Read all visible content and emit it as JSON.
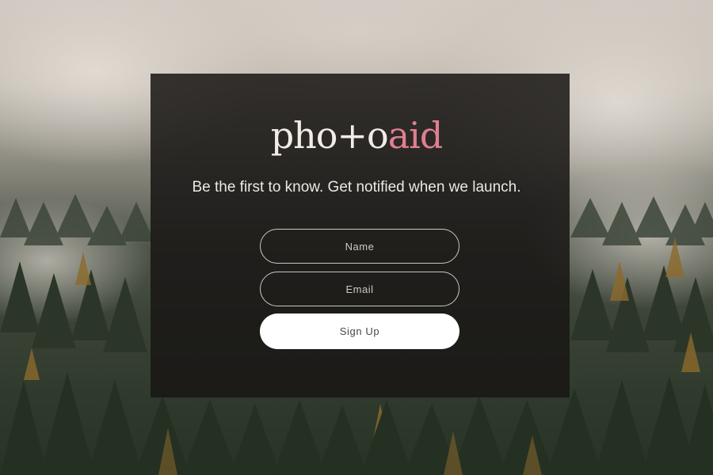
{
  "logo": {
    "part_a": "pho+o",
    "part_b": "aid"
  },
  "tagline": "Be the first to know. Get notified when we launch.",
  "form": {
    "name_placeholder": "Name",
    "email_placeholder": "Email",
    "signup_label": "Sign Up"
  },
  "colors": {
    "accent": "#e07f8e",
    "panel": "#181615",
    "button": "#ffffff"
  }
}
